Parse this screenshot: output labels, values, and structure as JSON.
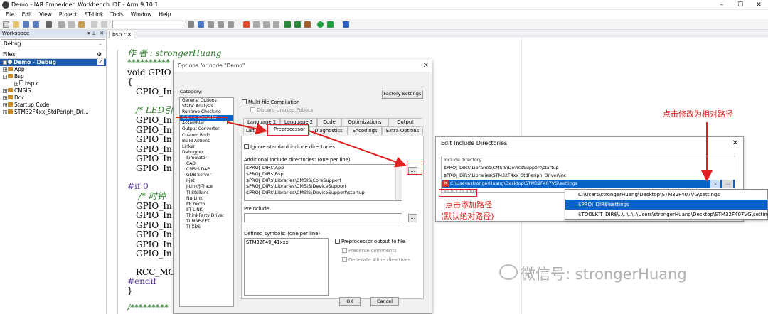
{
  "window": {
    "title": "Demo - IAR Embedded Workbench IDE - Arm 9.10.1"
  },
  "menu": [
    "File",
    "Edit",
    "View",
    "Project",
    "ST-Link",
    "Tools",
    "Window",
    "Help"
  ],
  "workspace": {
    "title": "Workspace",
    "config": "Debug",
    "files_label": "Files",
    "tree": [
      {
        "label": "Demo - Debug",
        "level": 0,
        "selected": true
      },
      {
        "label": "App",
        "level": 1
      },
      {
        "label": "Bsp",
        "level": 1
      },
      {
        "label": "bsp.c",
        "level": 2
      },
      {
        "label": "CMSIS",
        "level": 1
      },
      {
        "label": "Doc",
        "level": 1
      },
      {
        "label": "Startup Code",
        "level": 1
      },
      {
        "label": "STM32F4xx_StdPeriph_Dri...",
        "level": 1
      }
    ]
  },
  "editor": {
    "tab": "bsp.c",
    "lines": [
      "作    者 :  strongerHuang",
      "**********",
      "void GPIO",
      "{",
      "GPIO_In",
      "/* LED引",
      "GPIO_In",
      "GPIO_In",
      "GPIO_In",
      "GPIO_In",
      "GPIO_In",
      "GPIO_In",
      "#if 0",
      "/* 时钟",
      "GPIO_In",
      "GPIO_In",
      "GPIO_In",
      "GPIO_In",
      "GPIO_In",
      "GPIO_In",
      "RCC_MCO",
      "#endif",
      "}",
      "/*********"
    ]
  },
  "options_dialog": {
    "title": "Options for node \"Demo\"",
    "category_label": "Category:",
    "factory_settings": "Factory Settings",
    "categories": [
      {
        "label": "General Options",
        "indent": false
      },
      {
        "label": "Static Analysis",
        "indent": false
      },
      {
        "label": "Runtime Checking",
        "indent": false
      },
      {
        "label": "C/C++ Compiler",
        "indent": false,
        "selected": true
      },
      {
        "label": "Assembler",
        "indent": false
      },
      {
        "label": "Output Converter",
        "indent": false
      },
      {
        "label": "Custom Build",
        "indent": false
      },
      {
        "label": "Build Actions",
        "indent": false
      },
      {
        "label": "Linker",
        "indent": false
      },
      {
        "label": "Debugger",
        "indent": false
      },
      {
        "label": "Simulator",
        "indent": true
      },
      {
        "label": "CADI",
        "indent": true
      },
      {
        "label": "CMSIS DAP",
        "indent": true
      },
      {
        "label": "GDB Server",
        "indent": true
      },
      {
        "label": "I-jet",
        "indent": true
      },
      {
        "label": "J-Link/J-Trace",
        "indent": true
      },
      {
        "label": "TI Stellaris",
        "indent": true
      },
      {
        "label": "Nu-Link",
        "indent": true
      },
      {
        "label": "PE micro",
        "indent": true
      },
      {
        "label": "ST-LINK",
        "indent": true
      },
      {
        "label": "Third-Party Driver",
        "indent": true
      },
      {
        "label": "TI MSP-FET",
        "indent": true
      },
      {
        "label": "TI XDS",
        "indent": true
      }
    ],
    "multi_file": "Multi-file Compilation",
    "discard_public": "Discard Unused Publics",
    "tabs_row1": [
      "Language 1",
      "Language 2",
      "Code",
      "Optimizations",
      "Output"
    ],
    "tabs_row2": [
      "List",
      "Preprocessor",
      "Diagnostics",
      "Encodings",
      "Extra Options"
    ],
    "ignore_std": "Ignore standard include directories",
    "include_label": "Additional include directories: (one per line)",
    "include_dirs": [
      "$PROJ_DIR$\\App",
      "$PROJ_DIR$\\Bsp",
      "$PROJ_DIR$\\Libraries\\CMSIS\\CoreSupport",
      "$PROJ_DIR$\\Libraries\\CMSIS\\DeviceSupport",
      "$PROJ_DIR$\\Libraries\\CMSIS\\DeviceSupport\\startup"
    ],
    "browse": "...",
    "preinclude_label": "Preinclude",
    "defined_label": "Defined symbols: (one per line)",
    "defined_symbols": [
      "STM32F40_41xxx"
    ],
    "pp_output": "Preprocessor output to file",
    "preserve_comments": "Preserve comments",
    "generate_line": "Generate #line directives",
    "ok": "OK",
    "cancel": "Cancel"
  },
  "edit_include_dialog": {
    "title": "Edit Include Directories",
    "header": "Include directory",
    "rows": [
      "$PROJ_DIR$\\Libraries\\CMSIS\\DeviceSupport\\startup",
      "$PROJ_DIR$\\Libraries\\STM32F4xx_StdPeriph_Driver\\inc"
    ],
    "edit_value": "C:\\Users\\strongerHuang\\Desktop\\STM32F407VG\\settings",
    "click_to_add": "<Click to add>",
    "dropdown_options": [
      "C:\\Users\\strongerHuang\\Desktop\\STM32F407VG\\settings",
      "$PROJ_DIR$\\settings",
      "$TOOLKIT_DIR$\\..\\..\\..\\..\\Users\\strongerHuang\\Desktop\\STM32F407VG\\settings"
    ]
  },
  "annotations": {
    "change_relative": "点击修改为相对路径",
    "click_add": "点击添加路径",
    "default_abs": "(默认绝对路径)"
  },
  "watermark": "微信号: strongerHuang",
  "colors": {
    "selection": "#0a64c8",
    "annotation": "#e02020",
    "comment": "#2a7a2a"
  }
}
